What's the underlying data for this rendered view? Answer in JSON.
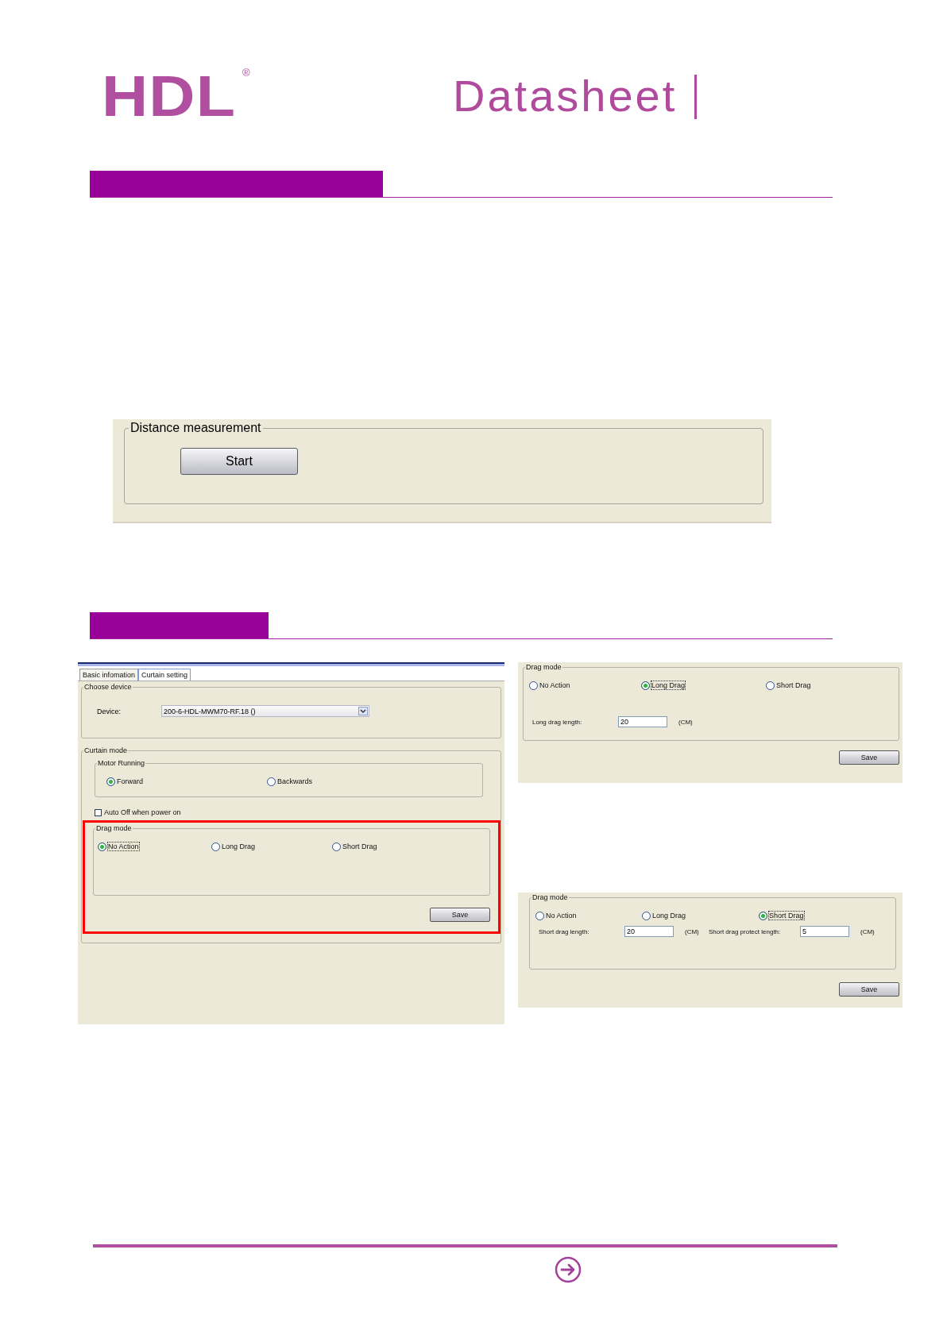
{
  "header": {
    "logo": "HDL",
    "logo_mark": "®",
    "title": "Datasheet"
  },
  "distance_panel": {
    "group": "Distance measurement",
    "button": "Start"
  },
  "main_window": {
    "tabs": [
      {
        "label": "Basic infomation",
        "selected": false
      },
      {
        "label": "Curtain setting",
        "selected": true
      }
    ],
    "choose_device": {
      "group": "Choose device",
      "label": "Device:",
      "value": "200-6-HDL-MWM70-RF.18 ()"
    },
    "curtain_mode": {
      "group": "Curtain mode",
      "motor_running": {
        "group": "Motor Running",
        "options": [
          {
            "label": "Forward",
            "selected": true
          },
          {
            "label": "Backwards",
            "selected": false
          }
        ]
      },
      "auto_off": {
        "label": "Auto Off when power on",
        "checked": false
      },
      "drag_mode": {
        "group": "Drag mode",
        "options": [
          {
            "label": "No Action",
            "selected": true
          },
          {
            "label": "Long Drag",
            "selected": false
          },
          {
            "label": "Short Drag",
            "selected": false
          }
        ]
      },
      "save": "Save"
    }
  },
  "drag_panels": [
    {
      "group": "Drag mode",
      "options": [
        {
          "label": "No Action",
          "selected": false
        },
        {
          "label": "Long Drag",
          "selected": true
        },
        {
          "label": "Short Drag",
          "selected": false
        }
      ],
      "fields": [
        {
          "label": "Long drag length:",
          "value": "20",
          "unit": "(CM)"
        }
      ],
      "save": "Save"
    },
    {
      "group": "Drag mode",
      "options": [
        {
          "label": "No Action",
          "selected": false
        },
        {
          "label": "Long Drag",
          "selected": false
        },
        {
          "label": "Short Drag",
          "selected": true
        }
      ],
      "fields": [
        {
          "label": "Short drag length:",
          "value": "20",
          "unit": "(CM)"
        },
        {
          "label": "Short drag protect length:",
          "value": "5",
          "unit": "(CM)"
        }
      ],
      "save": "Save"
    }
  ]
}
